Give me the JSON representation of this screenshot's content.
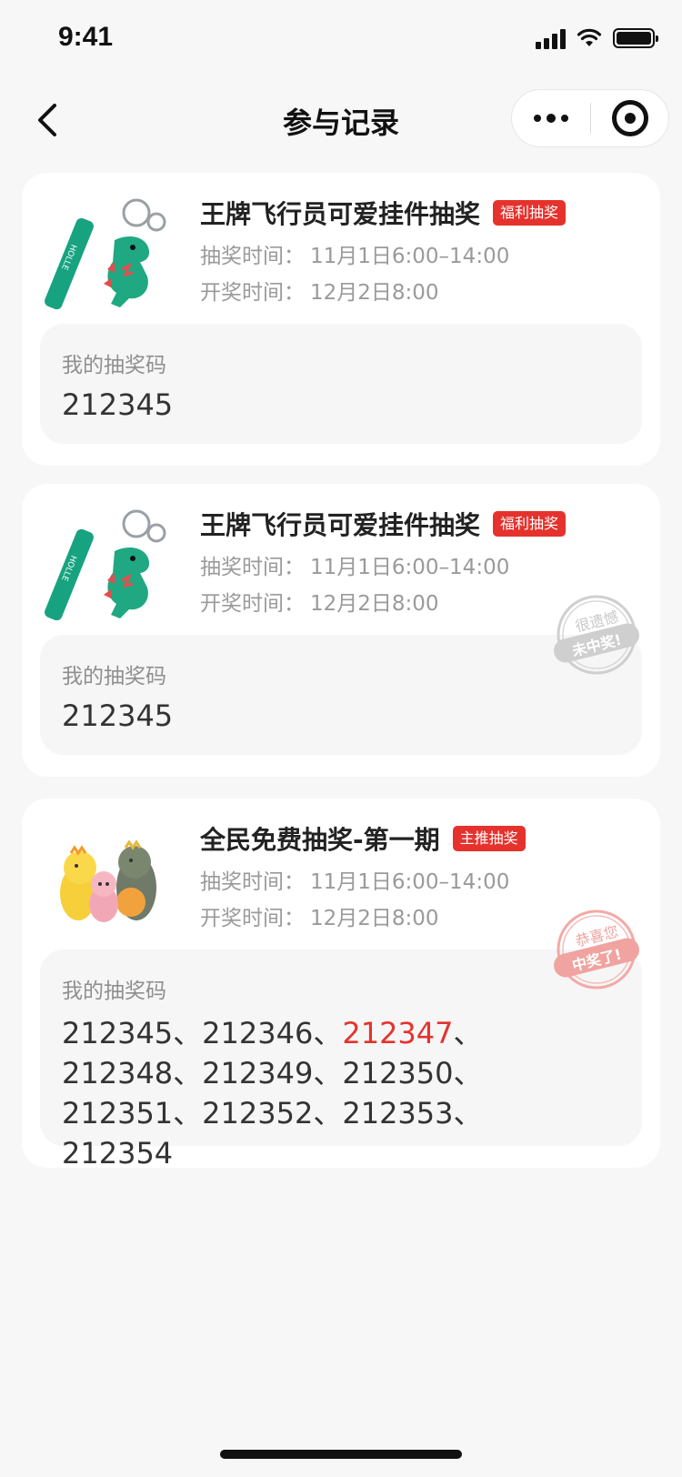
{
  "status_bar": {
    "time": "9:41"
  },
  "nav": {
    "title": "参与记录"
  },
  "records": [
    {
      "title": "王牌飞行员可爱挂件抽奖",
      "tag": "福利抽奖",
      "draw_time_label": "抽奖时间：",
      "draw_time": "11月1日6:00–14:00",
      "open_time_label": "开奖时间：",
      "open_time": "12月2日8:00",
      "code_label": "我的抽奖码",
      "code": "212345"
    },
    {
      "title": "王牌飞行员可爱挂件抽奖",
      "tag": "福利抽奖",
      "draw_time_label": "抽奖时间：",
      "draw_time": "11月1日6:00–14:00",
      "open_time_label": "开奖时间：",
      "open_time": "12月2日8:00",
      "code_label": "我的抽奖码",
      "code": "212345",
      "stamp": {
        "line1": "很遗憾",
        "line2": "未中奖!",
        "color": "#c8c8c8"
      }
    },
    {
      "title": "全民免费抽奖-第一期",
      "tag": "主推抽奖",
      "draw_time_label": "抽奖时间：",
      "draw_time": "11月1日6:00–14:00",
      "open_time_label": "开奖时间：",
      "open_time": "12月2日8:00",
      "code_label": "我的抽奖码",
      "codes": [
        "212345",
        "212346",
        "212347",
        "212348",
        "212349",
        "212350",
        "212351",
        "212352",
        "212353",
        "212354"
      ],
      "separator": "、",
      "winning_code": "212347",
      "stamp": {
        "line1": "恭喜您",
        "line2": "中奖了!",
        "color": "#f0a3a0"
      }
    }
  ],
  "colors": {
    "accent": "#e5322d",
    "background": "#f7f7f7",
    "card": "#ffffff",
    "code_box": "#f6f6f6"
  }
}
